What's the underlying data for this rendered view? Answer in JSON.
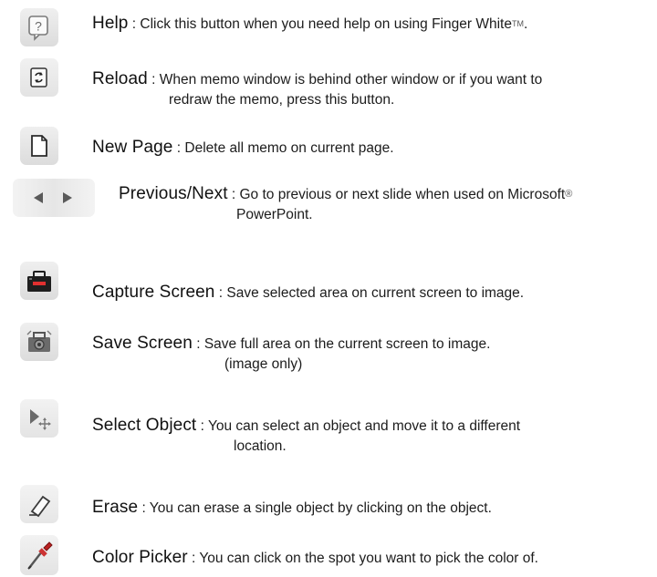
{
  "items": [
    {
      "icon": "help-icon",
      "name": "Help",
      "desc": "Click this button when you need help on using Finger White",
      "trademark": "TM",
      "desc_end": "."
    },
    {
      "icon": "reload-icon",
      "name": "Reload",
      "desc": "When memo window is behind other window or if you want to",
      "desc2": "redraw the memo, press this button."
    },
    {
      "icon": "new-page-icon",
      "name": "New Page",
      "desc": "Delete all memo on current page."
    },
    {
      "icon": "previous-next-arrows-icon",
      "name": "Previous/Next",
      "desc": "Go to previous or next slide when used on Microsoft",
      "registered": "®",
      "desc2": "PowerPoint."
    },
    {
      "icon": "capture-screen-icon",
      "name": "Capture Screen",
      "desc": "Save selected area on current screen to image."
    },
    {
      "icon": "save-screen-icon",
      "name": "Save Screen",
      "desc": "Save full area on the current screen to image.",
      "desc2": "(image only)"
    },
    {
      "icon": "select-object-icon",
      "name": "Select Object",
      "desc": "You can select an object and move it to a different",
      "desc2": "location."
    },
    {
      "icon": "eraser-icon",
      "name": "Erase",
      "desc": "You can erase a single object by clicking on the object."
    },
    {
      "icon": "color-picker-icon",
      "name": "Color Picker",
      "desc": "You can click on the spot you want to pick the color of."
    }
  ],
  "colors": {
    "icon_bg": "#e4e4e4",
    "text": "#1c1c1c",
    "icon_dark": "#1e1e1e",
    "arrow": "#5a5a5a"
  }
}
